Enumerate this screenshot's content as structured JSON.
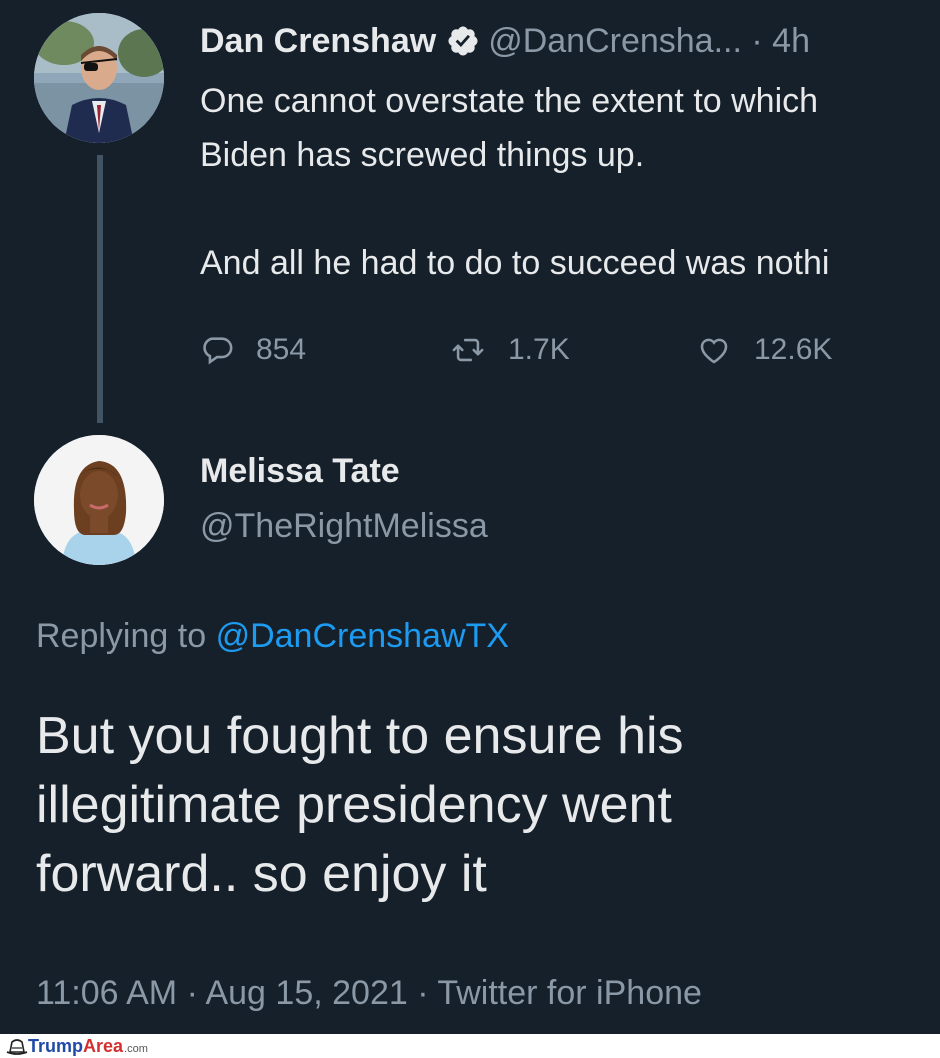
{
  "parent_tweet": {
    "author_name": "Dan Crenshaw",
    "author_handle": "@DanCrensha...",
    "time": "· 4h",
    "text_lines": [
      "One cannot overstate the extent to which",
      "Biden has screwed things up.",
      "And all he had to do to succeed was nothi"
    ],
    "reply_count": "854",
    "retweet_count": "1.7K",
    "like_count": "12.6K"
  },
  "reply_tweet": {
    "author_name": "Melissa Tate",
    "author_handle": "@TheRightMelissa",
    "replying_prefix": "Replying to",
    "replying_to": "@DanCrenshawTX",
    "text_lines": [
      "But you fought to ensure his",
      "illegitimate presidency went",
      "forward.. so enjoy it"
    ],
    "timestamp": "11:06 AM · Aug 15, 2021 · Twitter for iPhone"
  },
  "watermark": {
    "part1": "Trump",
    "part2": "Area",
    "suffix": ".com"
  },
  "colors": {
    "background": "#15202b",
    "text": "#e7e9ea",
    "secondary_text": "#8b98a5",
    "link": "#1d9bf0",
    "verified": "#e7e9ea"
  },
  "icons": [
    "verified-badge-icon",
    "reply-icon",
    "retweet-icon",
    "like-icon",
    "hat-logo-icon"
  ]
}
